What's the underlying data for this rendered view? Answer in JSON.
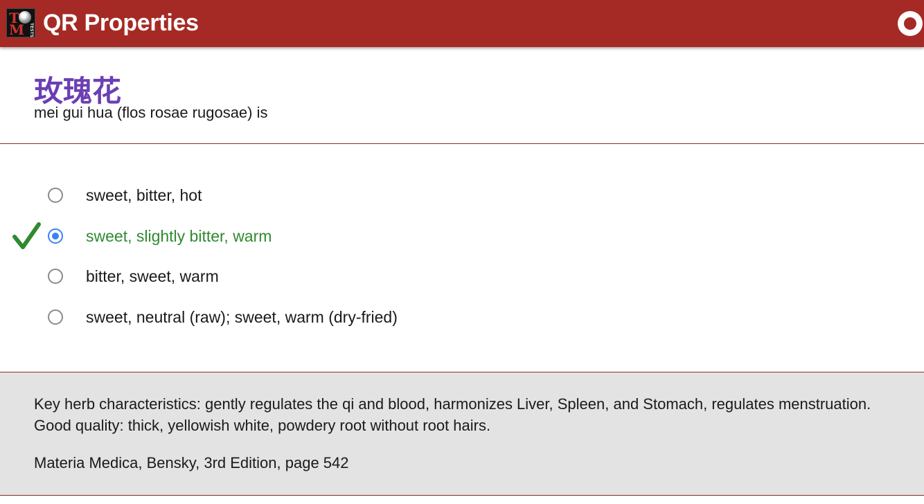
{
  "header": {
    "title": "QR Properties",
    "logo_text": "TCM TESTS",
    "brand_color": "#a52a25",
    "record_icon": "record-icon"
  },
  "question": {
    "herb_chinese": "玫瑰花",
    "prompt": "mei gui hua (flos rosae rugosae) is"
  },
  "answers": [
    {
      "label": "sweet, bitter, hot",
      "selected": false,
      "correct": false
    },
    {
      "label": "sweet, slightly bitter, warm",
      "selected": true,
      "correct": true
    },
    {
      "label": "bitter, sweet, warm",
      "selected": false,
      "correct": false
    },
    {
      "label": "sweet, neutral (raw); sweet, warm (dry-fried)",
      "selected": false,
      "correct": false
    }
  ],
  "explanation": {
    "text": "Key herb characteristics: gently regulates the qi and blood, harmonizes Liver, Spleen, and Stomach, regulates menstruation. Good quality: thick, yellowish white, powdery root without root hairs.",
    "reference": "Materia Medica, Bensky, 3rd Edition, page 542"
  },
  "colors": {
    "correct": "#2f8a2f",
    "radio_selected": "#3b82f6",
    "herb_name": "#6b3fb3"
  }
}
